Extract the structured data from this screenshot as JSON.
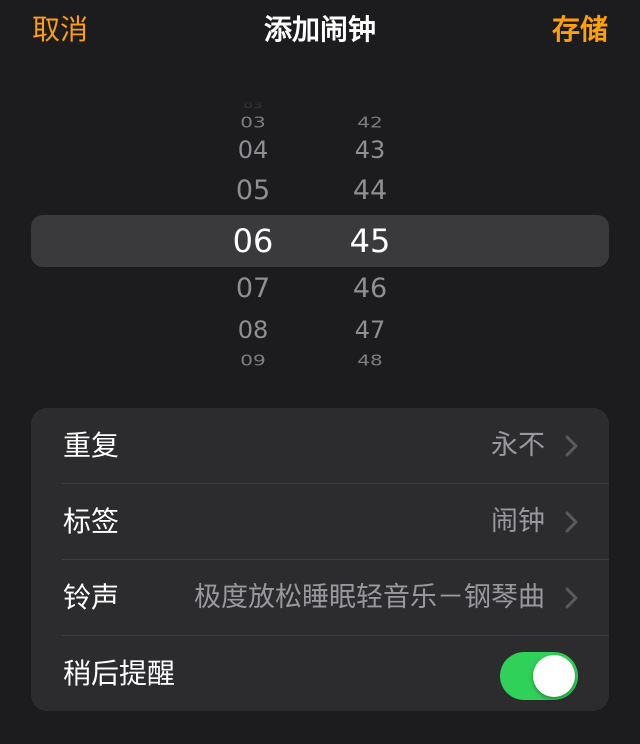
{
  "nav": {
    "cancel_label": "取消",
    "title": "添加闹钟",
    "save_label": "存储"
  },
  "picker": {
    "hours": [
      "03",
      "04",
      "05",
      "06",
      "07",
      "08",
      "09"
    ],
    "minutes": [
      "42",
      "43",
      "44",
      "45",
      "46",
      "47",
      "48"
    ],
    "selected_hour": "06",
    "selected_minute": "45"
  },
  "settings": {
    "repeat": {
      "label": "重复",
      "value": "永不"
    },
    "label": {
      "label": "标签",
      "value": "闹钟"
    },
    "sound": {
      "label": "铃声",
      "value": "极度放松睡眠轻音乐－钢琴曲"
    },
    "snooze": {
      "label": "稍后提醒",
      "enabled": true
    }
  },
  "colors": {
    "accent": "#ff9f0a",
    "toggle_on": "#30d158",
    "background": "#1c1c1e",
    "group_background": "#2c2c2e"
  },
  "icons": {
    "chevron": "chevron-right-icon"
  }
}
